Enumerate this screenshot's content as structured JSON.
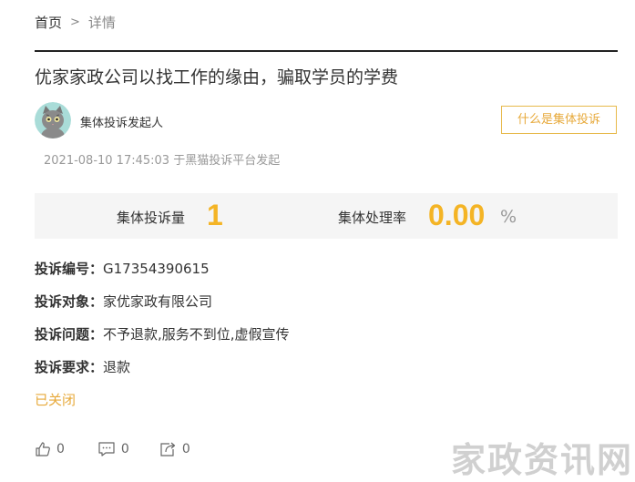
{
  "breadcrumb": {
    "home": "首页",
    "separator": ">",
    "current": "详情"
  },
  "title": "优家家政公司以找工作的缘由，骗取学员的学费",
  "author": {
    "name": "集体投诉发起人"
  },
  "whatis_button": "什么是集体投诉",
  "meta": "2021-08-10 17:45:03 于黑猫投诉平台发起",
  "stats": {
    "count_label": "集体投诉量",
    "count_value": "1",
    "rate_label": "集体处理率",
    "rate_value": "0.00",
    "rate_unit": "%"
  },
  "details": [
    {
      "key": "投诉编号：",
      "value": "G17354390615"
    },
    {
      "key": "投诉对象：",
      "value": "家优家政有限公司"
    },
    {
      "key": "投诉问题：",
      "value": "不予退款,服务不到位,虚假宣传"
    },
    {
      "key": "投诉要求：",
      "value": "退款"
    }
  ],
  "status": "已关闭",
  "actions": {
    "like_count": "0",
    "comment_count": "0",
    "share_count": "0"
  },
  "watermark": "家政资讯网",
  "colors": {
    "accent": "#f4b425",
    "status": "#e7a93a"
  },
  "icons": [
    "thumb-up-icon",
    "comment-icon",
    "share-icon"
  ]
}
